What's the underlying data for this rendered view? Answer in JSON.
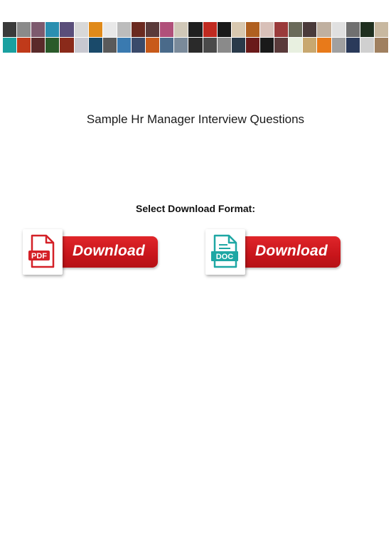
{
  "banner": {
    "description": "collage of movie/album poster thumbnails",
    "tile_colors": [
      "#3a3a3a",
      "#8a8a8a",
      "#7d5a6e",
      "#2a8fb0",
      "#5a4e7a",
      "#d8d8d8",
      "#e08a1a",
      "#e8e8e8",
      "#bcbcbc",
      "#6b2a20",
      "#5a3a3a",
      "#b0507a",
      "#d0c8b8",
      "#202020",
      "#c02a20",
      "#1a1a1a",
      "#d8c8b0",
      "#b06020",
      "#d8c0b8",
      "#9a3a3a",
      "#6a6a5a",
      "#4a3a3a",
      "#c0b0a0",
      "#e0e0e0",
      "#707070",
      "#203020",
      "#c8b8a0",
      "#1aa0a0",
      "#c03a1a",
      "#5a2a2a",
      "#2a5a2a",
      "#8a2a1a",
      "#c8c8d0",
      "#1a4a6a",
      "#5a5a5a",
      "#3a7ab0",
      "#3a4a6a",
      "#c85a1a",
      "#4a6a8a",
      "#7a8a9a",
      "#2a2a2a",
      "#4a4a4a",
      "#8a8a8a",
      "#2a3a4a",
      "#6a1a1a",
      "#1a1a1a",
      "#5a3a3a",
      "#e8f0e0",
      "#c8a870",
      "#e87a1a",
      "#a0a0a0",
      "#2a3a5a",
      "#d0d0d0",
      "#a08060"
    ]
  },
  "document": {
    "title": "Sample Hr Manager Interview Questions",
    "select_label": "Select Download Format:"
  },
  "downloads": [
    {
      "format": "PDF",
      "icon": "pdf-file-icon",
      "label": "Download",
      "accent": "#d42027"
    },
    {
      "format": "DOC",
      "icon": "doc-file-icon",
      "label": "Download",
      "accent": "#1ea7a4"
    }
  ]
}
